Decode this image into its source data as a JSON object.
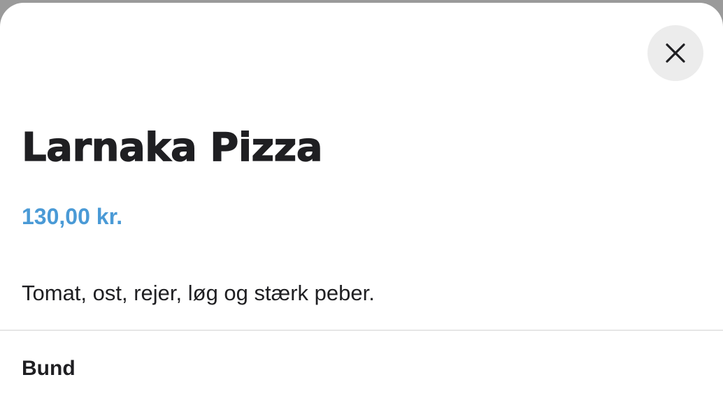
{
  "modal": {
    "close_icon": "close-icon",
    "title": "Larnaka Pizza",
    "price": "130,00 kr.",
    "description": "Tomat, ost, rejer, løg og stærk peber.",
    "section_label": "Bund"
  },
  "colors": {
    "price": "#4a9ad6",
    "text": "#1f1f22",
    "close_bg": "#ececec"
  }
}
